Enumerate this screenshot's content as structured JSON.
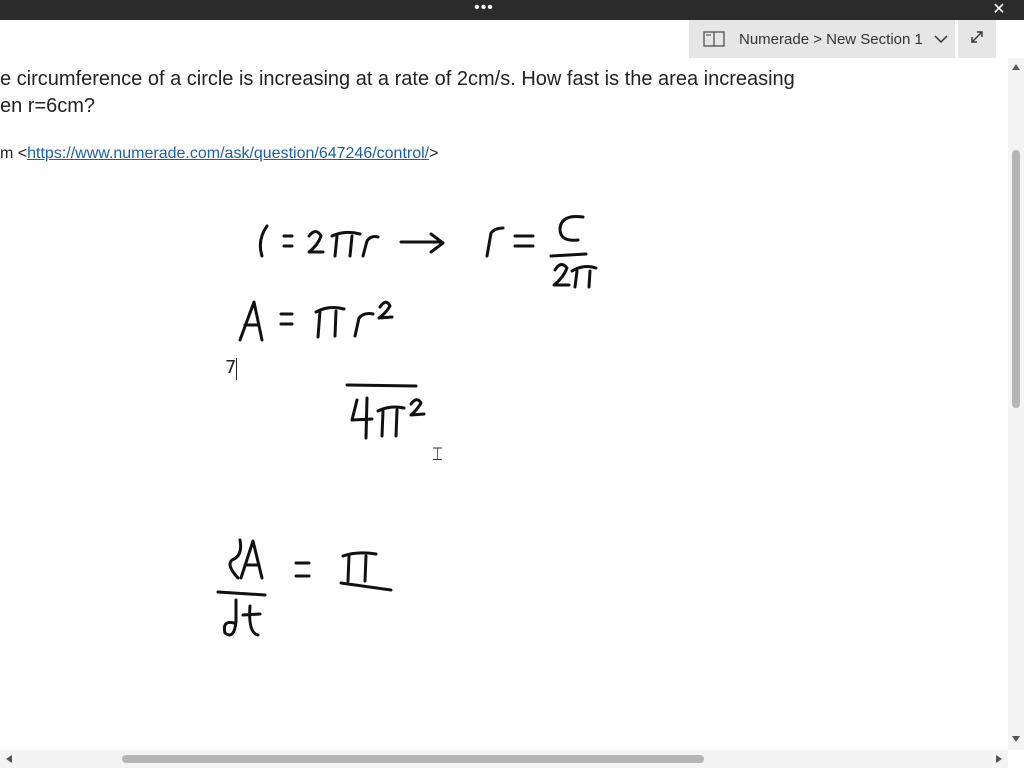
{
  "titlebar": {
    "more_label": "•••",
    "close_label": "✕"
  },
  "section": {
    "label": "Numerade > New Section 1",
    "icon": "book-icon",
    "chevron_icon": "chevron-down-icon"
  },
  "expand": {
    "icon": "expand-icon"
  },
  "page": {
    "question_line1": "e circumference of a circle is increasing at a rate of 2cm/s. How fast is the area increasing",
    "question_line2": "en r=6cm?",
    "source_prefix": "m <",
    "source_link": "https://www.numerade.com/ask/question/647246/control/",
    "source_suffix": ">",
    "typed_text": "7"
  },
  "ink": {
    "description_icon": "handwriting-ink",
    "color": "#111111"
  },
  "cursor": {
    "icon": "text-ibeam-icon",
    "glyph": "⌶"
  }
}
